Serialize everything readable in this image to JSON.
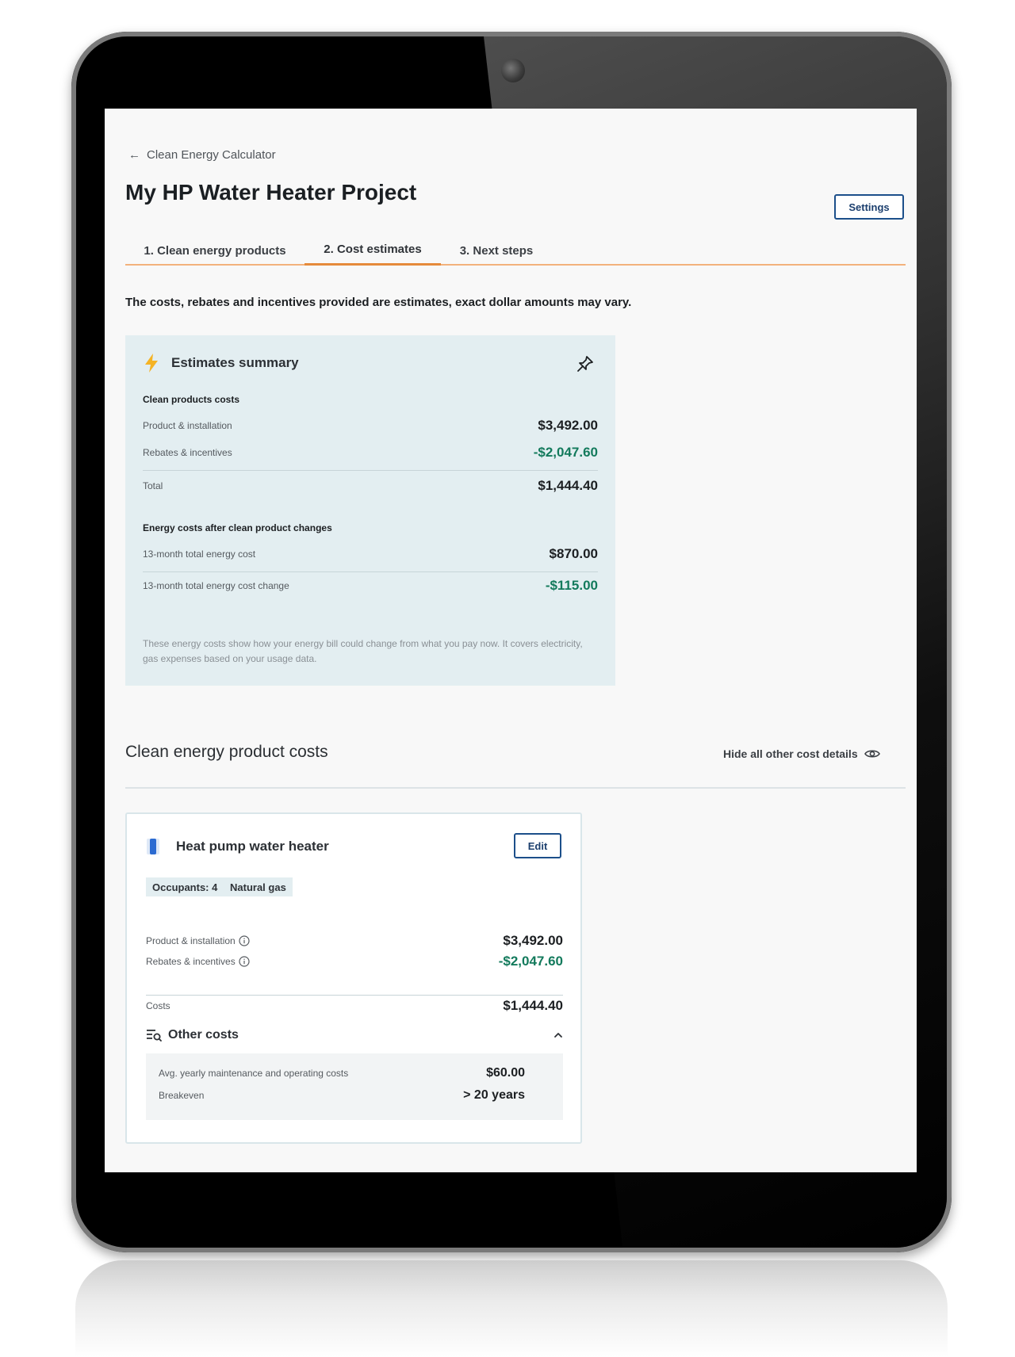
{
  "header": {
    "breadcrumb": "Clean Energy Calculator",
    "title": "My HP Water Heater Project",
    "settings_label": "Settings"
  },
  "tabs": [
    {
      "label": "1. Clean energy products",
      "active": false
    },
    {
      "label": "2. Cost estimates",
      "active": true
    },
    {
      "label": "3. Next steps",
      "active": false
    }
  ],
  "disclaimer": "The costs, rebates and incentives provided are estimates, exact dollar amounts may vary.",
  "summary": {
    "title": "Estimates summary",
    "clean_products": {
      "label": "Clean products costs",
      "product_installation_label": "Product & installation",
      "product_installation_value": "$3,492.00",
      "rebates_label": "Rebates & incentives",
      "rebates_value": "-$2,047.60",
      "total_label": "Total",
      "total_value": "$1,444.40"
    },
    "energy": {
      "label": "Energy costs after clean product changes",
      "total_cost_label": "13-month total energy cost",
      "total_cost_value": "$870.00",
      "cost_change_label": "13-month total energy cost change",
      "cost_change_value": "-$115.00"
    },
    "note": "These energy costs show how your energy bill could change from what you pay now. It covers electricity, gas expenses based on your usage data."
  },
  "product_costs": {
    "title": "Clean energy product costs",
    "hide_label": "Hide all other cost details"
  },
  "card": {
    "title": "Heat pump water heater",
    "edit_label": "Edit",
    "chips": [
      "Occupants: 4",
      "Natural gas"
    ],
    "product_installation_label": "Product & installation",
    "product_installation_value": "$3,492.00",
    "rebates_label": "Rebates & incentives",
    "rebates_value": "-$2,047.60",
    "costs_label": "Costs",
    "costs_value": "$1,444.40",
    "other_costs": {
      "title": "Other costs",
      "maintenance_label": "Avg. yearly maintenance and operating costs",
      "maintenance_value": "$60.00",
      "breakeven_label": "Breakeven",
      "breakeven_value": "> 20 years"
    }
  },
  "colors": {
    "accent_orange": "#e58a3b",
    "button_blue": "#1c4f8a",
    "negative_green": "#137a5c",
    "summary_bg": "#e3eef1"
  },
  "icons": [
    "back-arrow-icon",
    "lightning-bolt-icon",
    "pin-icon",
    "eye-icon",
    "water-heater-icon",
    "info-icon",
    "filter-search-icon",
    "chevron-up-icon"
  ]
}
